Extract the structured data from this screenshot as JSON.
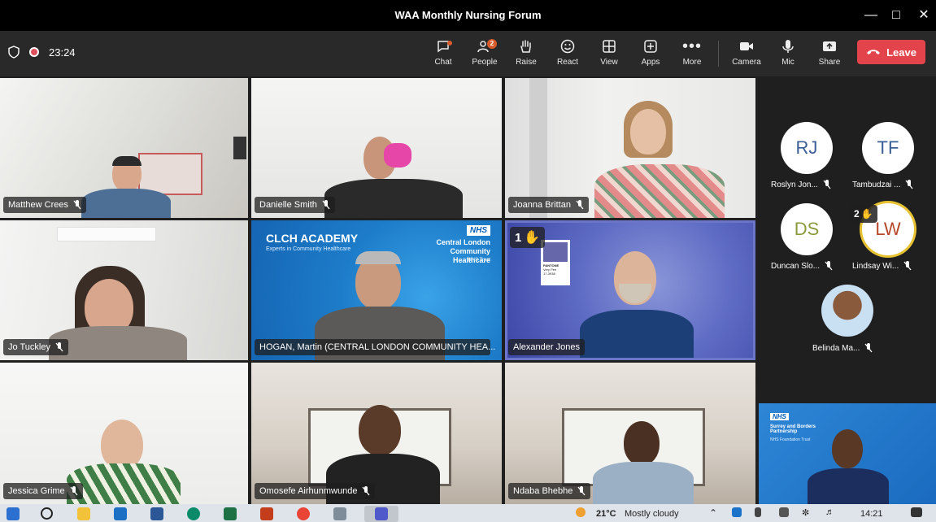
{
  "window": {
    "title": "WAA Monthly Nursing Forum"
  },
  "toolbar": {
    "timer": "23:24",
    "people_badge": "2",
    "buttons": {
      "chat": "Chat",
      "people": "People",
      "raise": "Raise",
      "react": "React",
      "view": "View",
      "apps": "Apps",
      "more": "More",
      "camera": "Camera",
      "mic": "Mic",
      "share": "Share"
    },
    "leave": "Leave",
    "colors": {
      "leave": "#e3434a",
      "badge": "#d95a2b",
      "highlight": "#6b76c9"
    }
  },
  "tiles": [
    {
      "name": "Matthew Crees"
    },
    {
      "name": "Danielle Smith"
    },
    {
      "name": "Joanna Brittan"
    },
    {
      "name": "Jo Tuckley"
    },
    {
      "name": "HOGAN, Martin (CENTRAL LONDON COMMUNITY HEA...",
      "bg_logo": "CLCH ACADEMY",
      "bg_logo_sub": "Experts in Community Healthcare",
      "bg_org": "Central London Community Healthcare",
      "bg_org_sub": "NHS Trust",
      "bg_nhs": "NHS"
    },
    {
      "name": "Alexander Jones",
      "raised_hand": "1",
      "bg_card": "PANTONE",
      "bg_card_sub": "Very Peri",
      "bg_card_code": "17-3938"
    },
    {
      "name": "Jessica Grime"
    },
    {
      "name": "Omosefe Airhunmwunde"
    },
    {
      "name": "Ndaba Bhebhe"
    }
  ],
  "panel": {
    "participants": [
      {
        "initials": "RJ",
        "name": "Roslyn Jon...",
        "color": "#3b5f94"
      },
      {
        "initials": "TF",
        "name": "Tambudzai ...",
        "color": "#3b5f94"
      },
      {
        "initials": "DS",
        "name": "Duncan Slo...",
        "color": "#8a9a3d"
      },
      {
        "initials": "LW",
        "name": "Lindsay Wi...",
        "color": "#b7472a",
        "raised_hand": "2"
      },
      {
        "initials": "",
        "name": "Belinda Ma..."
      }
    ],
    "share_tile": {
      "nhs": "NHS",
      "org": "Surrey and Borders Partnership",
      "org_sub": "NHS Foundation Trust"
    }
  },
  "taskbar": {
    "weather_temp": "21°C",
    "weather_text": "Mostly cloudy",
    "clock": "14:21"
  }
}
